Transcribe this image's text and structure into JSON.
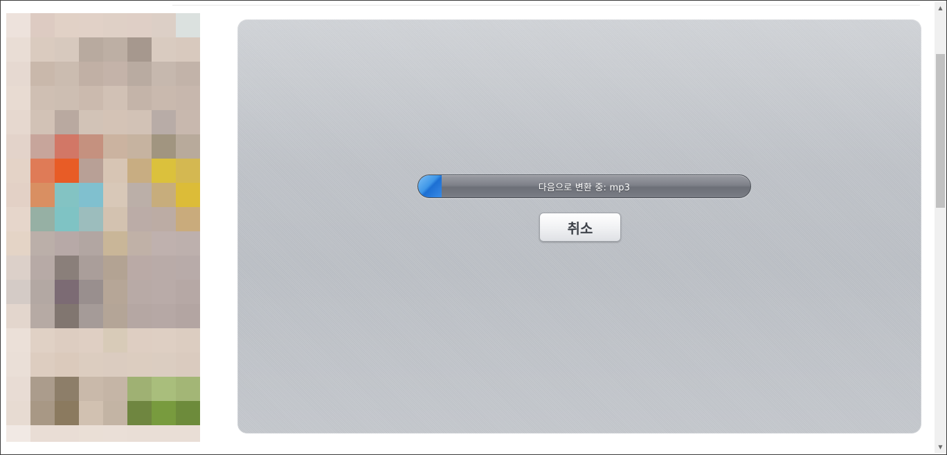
{
  "converter": {
    "status_text": "다음으로 변환 중: mp3",
    "progress_fraction": 0.07,
    "cancel_label": "취소"
  },
  "scrollbar": {
    "up_arrow_icon": "triangle-up-icon",
    "down_arrow_icon": "triangle-down-icon"
  },
  "ad": {
    "mosaic_colors": [
      "#ede2dc",
      "#ddcbc2",
      "#e1d1c6",
      "#e1d1c7",
      "#dfd0c6",
      "#dfcfc6",
      "#dccfc6",
      "#dbe1df",
      "#ffffff",
      "#e9ddd5",
      "#dacbbf",
      "#d7c9be",
      "#b8aa9f",
      "#bdafa4",
      "#a6988e",
      "#d9cbc0",
      "#d8c9be",
      "#ffffff",
      "#e6d9d1",
      "#c9b8ab",
      "#cbbcb0",
      "#c1b0a5",
      "#c4b3a9",
      "#b9aba1",
      "#c6b8ae",
      "#c2b3a9",
      "#ffffff",
      "#e8dbd2",
      "#cfbfb3",
      "#cdbeb2",
      "#cbbaae",
      "#d1c1b5",
      "#c4b4a9",
      "#c9b9ae",
      "#c7b7ad",
      "#ffffff",
      "#e6d8cf",
      "#d2c2b6",
      "#b9a9a0",
      "#d2c3b7",
      "#d4c3b6",
      "#d2c2b6",
      "#b8aca7",
      "#c8b8ae",
      "#ffffff",
      "#e3d3ca",
      "#c7a59b",
      "#d27766",
      "#c5917f",
      "#cbb3a0",
      "#c6b3a0",
      "#a19580",
      "#b8aa9b",
      "#ffffff",
      "#e4d3c7",
      "#df7b57",
      "#e85c26",
      "#b8a096",
      "#d7c5b4",
      "#c8ad82",
      "#dbc13c",
      "#d4b851",
      "#ffffff",
      "#e3d1c6",
      "#d98f62",
      "#83c3c3",
      "#80c0cf",
      "#d8c8b8",
      "#bbafa8",
      "#c7ad7c",
      "#dcbc38",
      "#ffffff",
      "#e6d6cb",
      "#96b0a4",
      "#7fc3c4",
      "#9cbdbd",
      "#d3c2b0",
      "#bbaca7",
      "#bcaca4",
      "#c9ab7c",
      "#ffffff",
      "#e4d4c6",
      "#bbafa9",
      "#b7a9a7",
      "#b2a6a2",
      "#c9b698",
      "#c0b1a7",
      "#bfb1ae",
      "#bdb0ad",
      "#ffffff",
      "#dcd0c9",
      "#b7aaa6",
      "#8a7f7a",
      "#aa9e9a",
      "#b3a393",
      "#baaaa6",
      "#b9aba8",
      "#b8aba9",
      "#ffffff",
      "#d4cbc6",
      "#b3a8a3",
      "#7c6b74",
      "#998f8e",
      "#b6a697",
      "#b8aaa6",
      "#b9aba8",
      "#b6a8a5",
      "#ffffff",
      "#e3d6cd",
      "#b6aaa4",
      "#817670",
      "#a59b98",
      "#b4a597",
      "#b5a7a3",
      "#b6a8a5",
      "#b3a5a2",
      "#ffffff",
      "#ebe0d8",
      "#e0d1c5",
      "#ddcdc1",
      "#dfcfc3",
      "#d8cbb8",
      "#decec2",
      "#decfc3",
      "#dccdc1",
      "#ffffff",
      "#eadfd7",
      "#ddcdc0",
      "#dbcabc",
      "#dccdc0",
      "#dbccc0",
      "#dccdc0",
      "#dbcdc1",
      "#dacbbf",
      "#ffffff",
      "#e8dcd4",
      "#ab9c8c",
      "#8d7e69",
      "#c9b9aa",
      "#c5b5a6",
      "#9fb173",
      "#a9be7c",
      "#a3b676",
      "#ffffff",
      "#e7dbd2",
      "#a89885",
      "#8b7a5f",
      "#d1c1b1",
      "#c3b4a4",
      "#6f8640",
      "#789b3e",
      "#6d8b3b",
      "#ffffff",
      "#f1e9e4",
      "#e9ddd5",
      "#e9ddd5",
      "#eadfd6",
      "#eadfd7",
      "#e9ded6",
      "#e9ded6",
      "#e9ded6",
      "#ffffff"
    ]
  }
}
